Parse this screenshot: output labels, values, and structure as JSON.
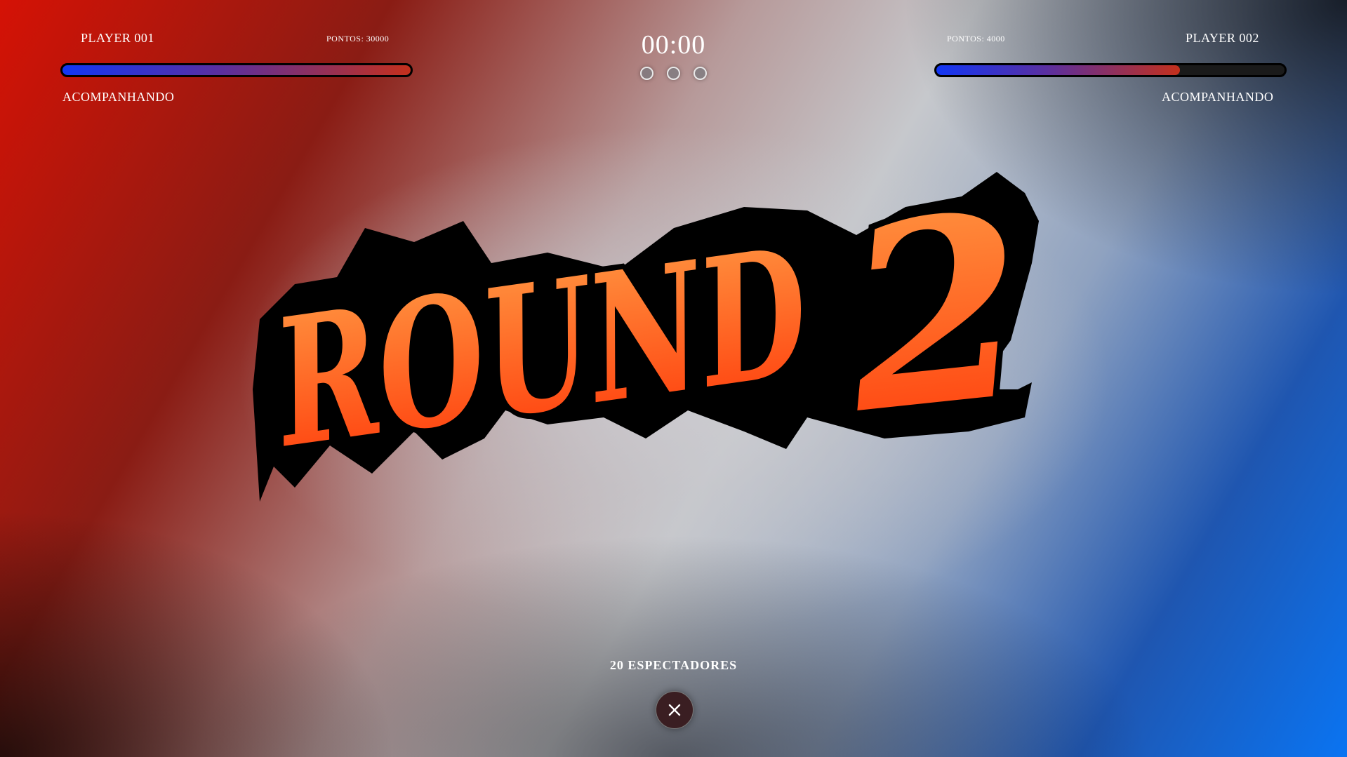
{
  "player1": {
    "name": "PLAYER 001",
    "points": "PONTOS: 30000",
    "status": "ACOMPANHANDO",
    "bar_fill_percent": 100
  },
  "player2": {
    "name": "PLAYER 002",
    "points": "PONTOS: 4000",
    "status": "ACOMPANHANDO",
    "bar_fill_percent": 70
  },
  "timer": "00:00",
  "round_indicators": 3,
  "banner": {
    "word": "ROUND",
    "number": "2",
    "fill_top": "#ff9a44",
    "fill_bottom": "#ff3a0a"
  },
  "spectators": "20 ESPECTADORES",
  "close_icon": "close-icon",
  "colors": {
    "red_side": "#d51205",
    "blue_side": "#0a74f2",
    "bar_start": "#1236f5",
    "bar_end": "#c4301c"
  }
}
